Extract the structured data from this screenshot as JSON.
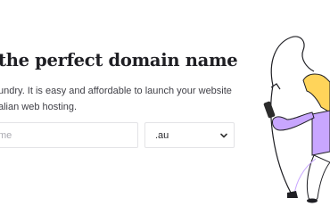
{
  "hero": {
    "headline": "the perfect domain name",
    "subtext_line1": "undry. It is easy and affordable to launch your website",
    "subtext_line2": "alian web hosting."
  },
  "search": {
    "placeholder": "me"
  },
  "tld_select": {
    "selected": ".au"
  },
  "colors": {
    "lilac": "#c8a6ff",
    "yellow": "#ffd45a",
    "ink": "#1f1f24"
  }
}
